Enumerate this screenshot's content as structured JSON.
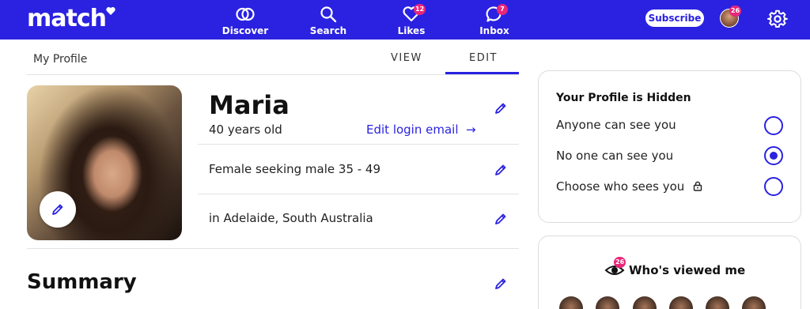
{
  "nav": {
    "logo": "match",
    "items": [
      {
        "label": "Discover",
        "icon": "discover-icon"
      },
      {
        "label": "Search",
        "icon": "search-icon"
      },
      {
        "label": "Likes",
        "icon": "heart-icon",
        "badge": "12"
      },
      {
        "label": "Inbox",
        "icon": "chat-icon",
        "badge": "7"
      }
    ],
    "subscribe": "Subscribe",
    "avatar_badge": "26",
    "settings_icon": "gear-icon"
  },
  "page": {
    "title": "My Profile",
    "tabs": [
      {
        "label": "VIEW",
        "active": false
      },
      {
        "label": "EDIT",
        "active": true
      }
    ]
  },
  "profile": {
    "name": "Maria",
    "age": "40 years old",
    "edit_login": "Edit login email",
    "seeking": "Female seeking male 35 - 49",
    "location": "in Adelaide, South Australia",
    "summary_heading": "Summary"
  },
  "visibility": {
    "title": "Your Profile is Hidden",
    "options": [
      {
        "label": "Anyone can see you",
        "selected": false
      },
      {
        "label": "No one can see you",
        "selected": true
      },
      {
        "label": "Choose who sees you",
        "selected": false,
        "icon": "lock-icon"
      }
    ]
  },
  "viewed": {
    "title": "Who's viewed me",
    "badge": "26"
  },
  "colors": {
    "brand": "#2a22e0",
    "badge": "#e8267a"
  }
}
